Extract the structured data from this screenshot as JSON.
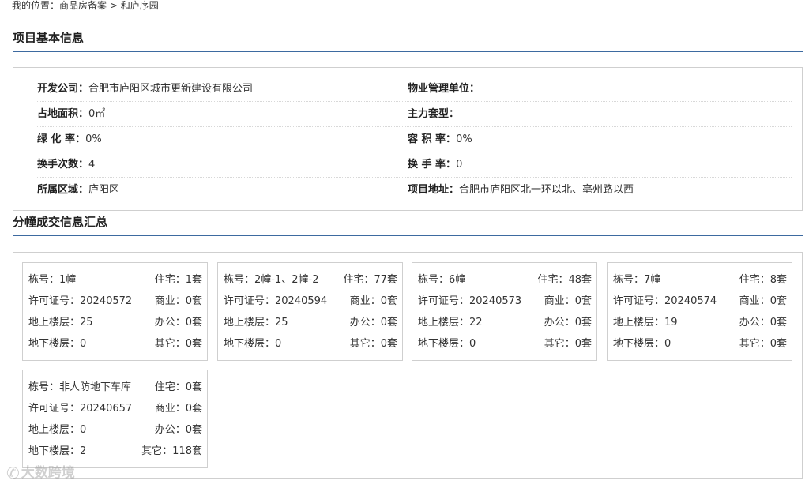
{
  "breadcrumb": {
    "label": "我的位置：",
    "trail": "商品房备案 > 和庐序园"
  },
  "sections": {
    "basic_info_title": "项目基本信息",
    "units_title": "分幢成交信息汇总"
  },
  "basic_info": {
    "developer_label": "开发公司：",
    "developer_value": "合肥市庐阳区城市更新建设有限公司",
    "property_mgmt_label": "物业管理单位：",
    "property_mgmt_value": "",
    "land_area_label": "占地面积：",
    "land_area_value": "0㎡",
    "main_type_label": "主力套型：",
    "main_type_value": "",
    "green_rate_label": "绿 化 率：",
    "green_rate_value": "0%",
    "plot_ratio_label": "容 积 率：",
    "plot_ratio_value": "0%",
    "transfer_count_label": "换手次数：",
    "transfer_count_value": "4",
    "turnover_rate_label": "换 手 率：",
    "turnover_rate_value": "0",
    "district_label": "所属区域：",
    "district_value": "庐阳区",
    "address_label": "项目地址：",
    "address_value": "合肥市庐阳区北一环以北、亳州路以西"
  },
  "buildings": [
    {
      "building": "栋号：1幢",
      "residential": "住宅：1套",
      "permit": "许可证号：20240572",
      "commercial": "商业：0套",
      "floors_above": "地上楼层：25",
      "office": "办公：0套",
      "floors_below": "地下楼层：0",
      "other": "其它：0套"
    },
    {
      "building": "栋号：2幢-1、2幢-2",
      "residential": "住宅：77套",
      "permit": "许可证号：20240594",
      "commercial": "商业：0套",
      "floors_above": "地上楼层：25",
      "office": "办公：0套",
      "floors_below": "地下楼层：0",
      "other": "其它：0套"
    },
    {
      "building": "栋号：6幢",
      "residential": "住宅：48套",
      "permit": "许可证号：20240573",
      "commercial": "商业：0套",
      "floors_above": "地上楼层：22",
      "office": "办公：0套",
      "floors_below": "地下楼层：0",
      "other": "其它：0套"
    },
    {
      "building": "栋号：7幢",
      "residential": "住宅：8套",
      "permit": "许可证号：20240574",
      "commercial": "商业：0套",
      "floors_above": "地上楼层：19",
      "office": "办公：0套",
      "floors_below": "地下楼层：0",
      "other": "其它：0套"
    },
    {
      "building": "栋号：非人防地下车库",
      "residential": "住宅：0套",
      "permit": "许可证号：20240657",
      "commercial": "商业：0套",
      "floors_above": "地上楼层：0",
      "office": "办公：0套",
      "floors_below": "地下楼层：2",
      "other": "其它：118套"
    }
  ],
  "watermark": {
    "text": "大数跨境",
    "icon": "chat-bubble-icon"
  }
}
